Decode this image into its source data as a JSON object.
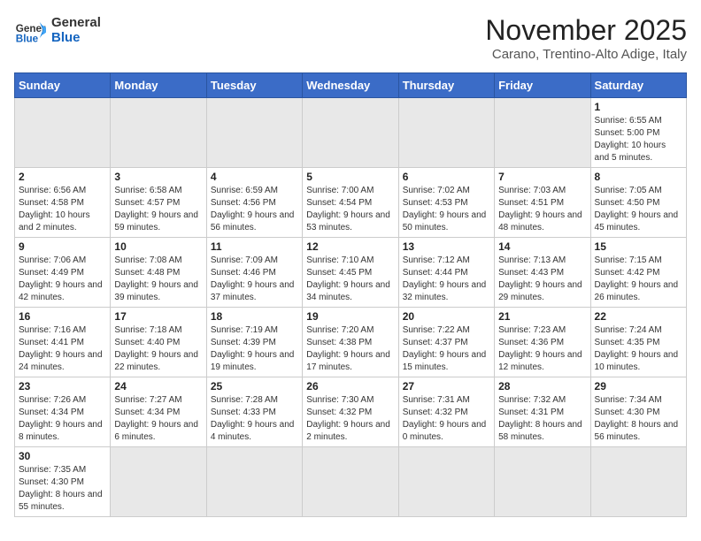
{
  "header": {
    "logo_line1": "General",
    "logo_line2": "Blue",
    "month_year": "November 2025",
    "location": "Carano, Trentino-Alto Adige, Italy"
  },
  "weekdays": [
    "Sunday",
    "Monday",
    "Tuesday",
    "Wednesday",
    "Thursday",
    "Friday",
    "Saturday"
  ],
  "weeks": [
    [
      {
        "day": "",
        "info": "",
        "empty": true
      },
      {
        "day": "",
        "info": "",
        "empty": true
      },
      {
        "day": "",
        "info": "",
        "empty": true
      },
      {
        "day": "",
        "info": "",
        "empty": true
      },
      {
        "day": "",
        "info": "",
        "empty": true
      },
      {
        "day": "",
        "info": "",
        "empty": true
      },
      {
        "day": "1",
        "info": "Sunrise: 6:55 AM\nSunset: 5:00 PM\nDaylight: 10 hours and 5 minutes."
      }
    ],
    [
      {
        "day": "2",
        "info": "Sunrise: 6:56 AM\nSunset: 4:58 PM\nDaylight: 10 hours and 2 minutes."
      },
      {
        "day": "3",
        "info": "Sunrise: 6:58 AM\nSunset: 4:57 PM\nDaylight: 9 hours and 59 minutes."
      },
      {
        "day": "4",
        "info": "Sunrise: 6:59 AM\nSunset: 4:56 PM\nDaylight: 9 hours and 56 minutes."
      },
      {
        "day": "5",
        "info": "Sunrise: 7:00 AM\nSunset: 4:54 PM\nDaylight: 9 hours and 53 minutes."
      },
      {
        "day": "6",
        "info": "Sunrise: 7:02 AM\nSunset: 4:53 PM\nDaylight: 9 hours and 50 minutes."
      },
      {
        "day": "7",
        "info": "Sunrise: 7:03 AM\nSunset: 4:51 PM\nDaylight: 9 hours and 48 minutes."
      },
      {
        "day": "8",
        "info": "Sunrise: 7:05 AM\nSunset: 4:50 PM\nDaylight: 9 hours and 45 minutes."
      }
    ],
    [
      {
        "day": "9",
        "info": "Sunrise: 7:06 AM\nSunset: 4:49 PM\nDaylight: 9 hours and 42 minutes."
      },
      {
        "day": "10",
        "info": "Sunrise: 7:08 AM\nSunset: 4:48 PM\nDaylight: 9 hours and 39 minutes."
      },
      {
        "day": "11",
        "info": "Sunrise: 7:09 AM\nSunset: 4:46 PM\nDaylight: 9 hours and 37 minutes."
      },
      {
        "day": "12",
        "info": "Sunrise: 7:10 AM\nSunset: 4:45 PM\nDaylight: 9 hours and 34 minutes."
      },
      {
        "day": "13",
        "info": "Sunrise: 7:12 AM\nSunset: 4:44 PM\nDaylight: 9 hours and 32 minutes."
      },
      {
        "day": "14",
        "info": "Sunrise: 7:13 AM\nSunset: 4:43 PM\nDaylight: 9 hours and 29 minutes."
      },
      {
        "day": "15",
        "info": "Sunrise: 7:15 AM\nSunset: 4:42 PM\nDaylight: 9 hours and 26 minutes."
      }
    ],
    [
      {
        "day": "16",
        "info": "Sunrise: 7:16 AM\nSunset: 4:41 PM\nDaylight: 9 hours and 24 minutes."
      },
      {
        "day": "17",
        "info": "Sunrise: 7:18 AM\nSunset: 4:40 PM\nDaylight: 9 hours and 22 minutes."
      },
      {
        "day": "18",
        "info": "Sunrise: 7:19 AM\nSunset: 4:39 PM\nDaylight: 9 hours and 19 minutes."
      },
      {
        "day": "19",
        "info": "Sunrise: 7:20 AM\nSunset: 4:38 PM\nDaylight: 9 hours and 17 minutes."
      },
      {
        "day": "20",
        "info": "Sunrise: 7:22 AM\nSunset: 4:37 PM\nDaylight: 9 hours and 15 minutes."
      },
      {
        "day": "21",
        "info": "Sunrise: 7:23 AM\nSunset: 4:36 PM\nDaylight: 9 hours and 12 minutes."
      },
      {
        "day": "22",
        "info": "Sunrise: 7:24 AM\nSunset: 4:35 PM\nDaylight: 9 hours and 10 minutes."
      }
    ],
    [
      {
        "day": "23",
        "info": "Sunrise: 7:26 AM\nSunset: 4:34 PM\nDaylight: 9 hours and 8 minutes."
      },
      {
        "day": "24",
        "info": "Sunrise: 7:27 AM\nSunset: 4:34 PM\nDaylight: 9 hours and 6 minutes."
      },
      {
        "day": "25",
        "info": "Sunrise: 7:28 AM\nSunset: 4:33 PM\nDaylight: 9 hours and 4 minutes."
      },
      {
        "day": "26",
        "info": "Sunrise: 7:30 AM\nSunset: 4:32 PM\nDaylight: 9 hours and 2 minutes."
      },
      {
        "day": "27",
        "info": "Sunrise: 7:31 AM\nSunset: 4:32 PM\nDaylight: 9 hours and 0 minutes."
      },
      {
        "day": "28",
        "info": "Sunrise: 7:32 AM\nSunset: 4:31 PM\nDaylight: 8 hours and 58 minutes."
      },
      {
        "day": "29",
        "info": "Sunrise: 7:34 AM\nSunset: 4:30 PM\nDaylight: 8 hours and 56 minutes."
      }
    ],
    [
      {
        "day": "30",
        "info": "Sunrise: 7:35 AM\nSunset: 4:30 PM\nDaylight: 8 hours and 55 minutes."
      },
      {
        "day": "",
        "info": "",
        "empty": true
      },
      {
        "day": "",
        "info": "",
        "empty": true
      },
      {
        "day": "",
        "info": "",
        "empty": true
      },
      {
        "day": "",
        "info": "",
        "empty": true
      },
      {
        "day": "",
        "info": "",
        "empty": true
      },
      {
        "day": "",
        "info": "",
        "empty": true
      }
    ]
  ]
}
